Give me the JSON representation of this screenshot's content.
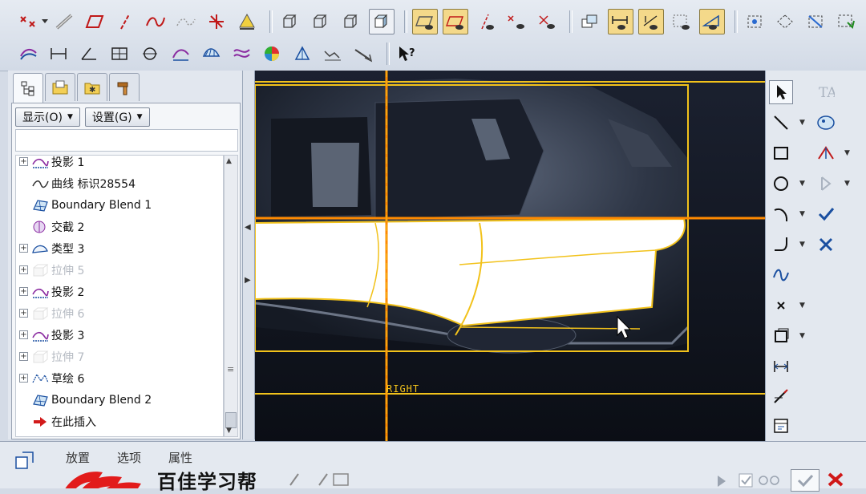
{
  "left_panel": {
    "show_button": "显示(O)",
    "settings_button": "设置(G)",
    "tree_items": [
      {
        "label": "投影 1",
        "icon": "projection-icon",
        "expandable": true,
        "disabled": false
      },
      {
        "label": "曲线 标识28554",
        "icon": "curve-icon",
        "expandable": false,
        "disabled": false
      },
      {
        "label": "Boundary Blend 1",
        "icon": "boundary-blend-icon",
        "expandable": false,
        "disabled": false
      },
      {
        "label": "交截 2",
        "icon": "intersect-icon",
        "expandable": false,
        "disabled": false
      },
      {
        "label": "类型 3",
        "icon": "style-icon",
        "expandable": true,
        "disabled": false
      },
      {
        "label": "拉伸 5",
        "icon": "extrude-icon",
        "expandable": true,
        "disabled": true
      },
      {
        "label": "投影 2",
        "icon": "projection-icon",
        "expandable": true,
        "disabled": false
      },
      {
        "label": "拉伸 6",
        "icon": "extrude-icon",
        "expandable": true,
        "disabled": true
      },
      {
        "label": "投影 3",
        "icon": "projection-icon",
        "expandable": true,
        "disabled": false
      },
      {
        "label": "拉伸 7",
        "icon": "extrude-icon",
        "expandable": true,
        "disabled": true
      },
      {
        "label": "草绘 6",
        "icon": "sketch-icon",
        "expandable": true,
        "disabled": false
      },
      {
        "label": "Boundary Blend 2",
        "icon": "boundary-blend-icon",
        "expandable": false,
        "disabled": false
      },
      {
        "label": "在此插入",
        "icon": "insert-here-icon",
        "expandable": false,
        "disabled": false
      }
    ]
  },
  "viewport": {
    "datum_label": "RIGHT"
  },
  "dashboard": {
    "tabs": [
      "放置",
      "选项",
      "属性"
    ],
    "brand_text": "百佳学习帮"
  },
  "colors": {
    "datum": "#f2c21b",
    "selection": "#ff8a00",
    "toolbar_bg": "#d8dfe9",
    "viewport_bg": "#10141d"
  }
}
